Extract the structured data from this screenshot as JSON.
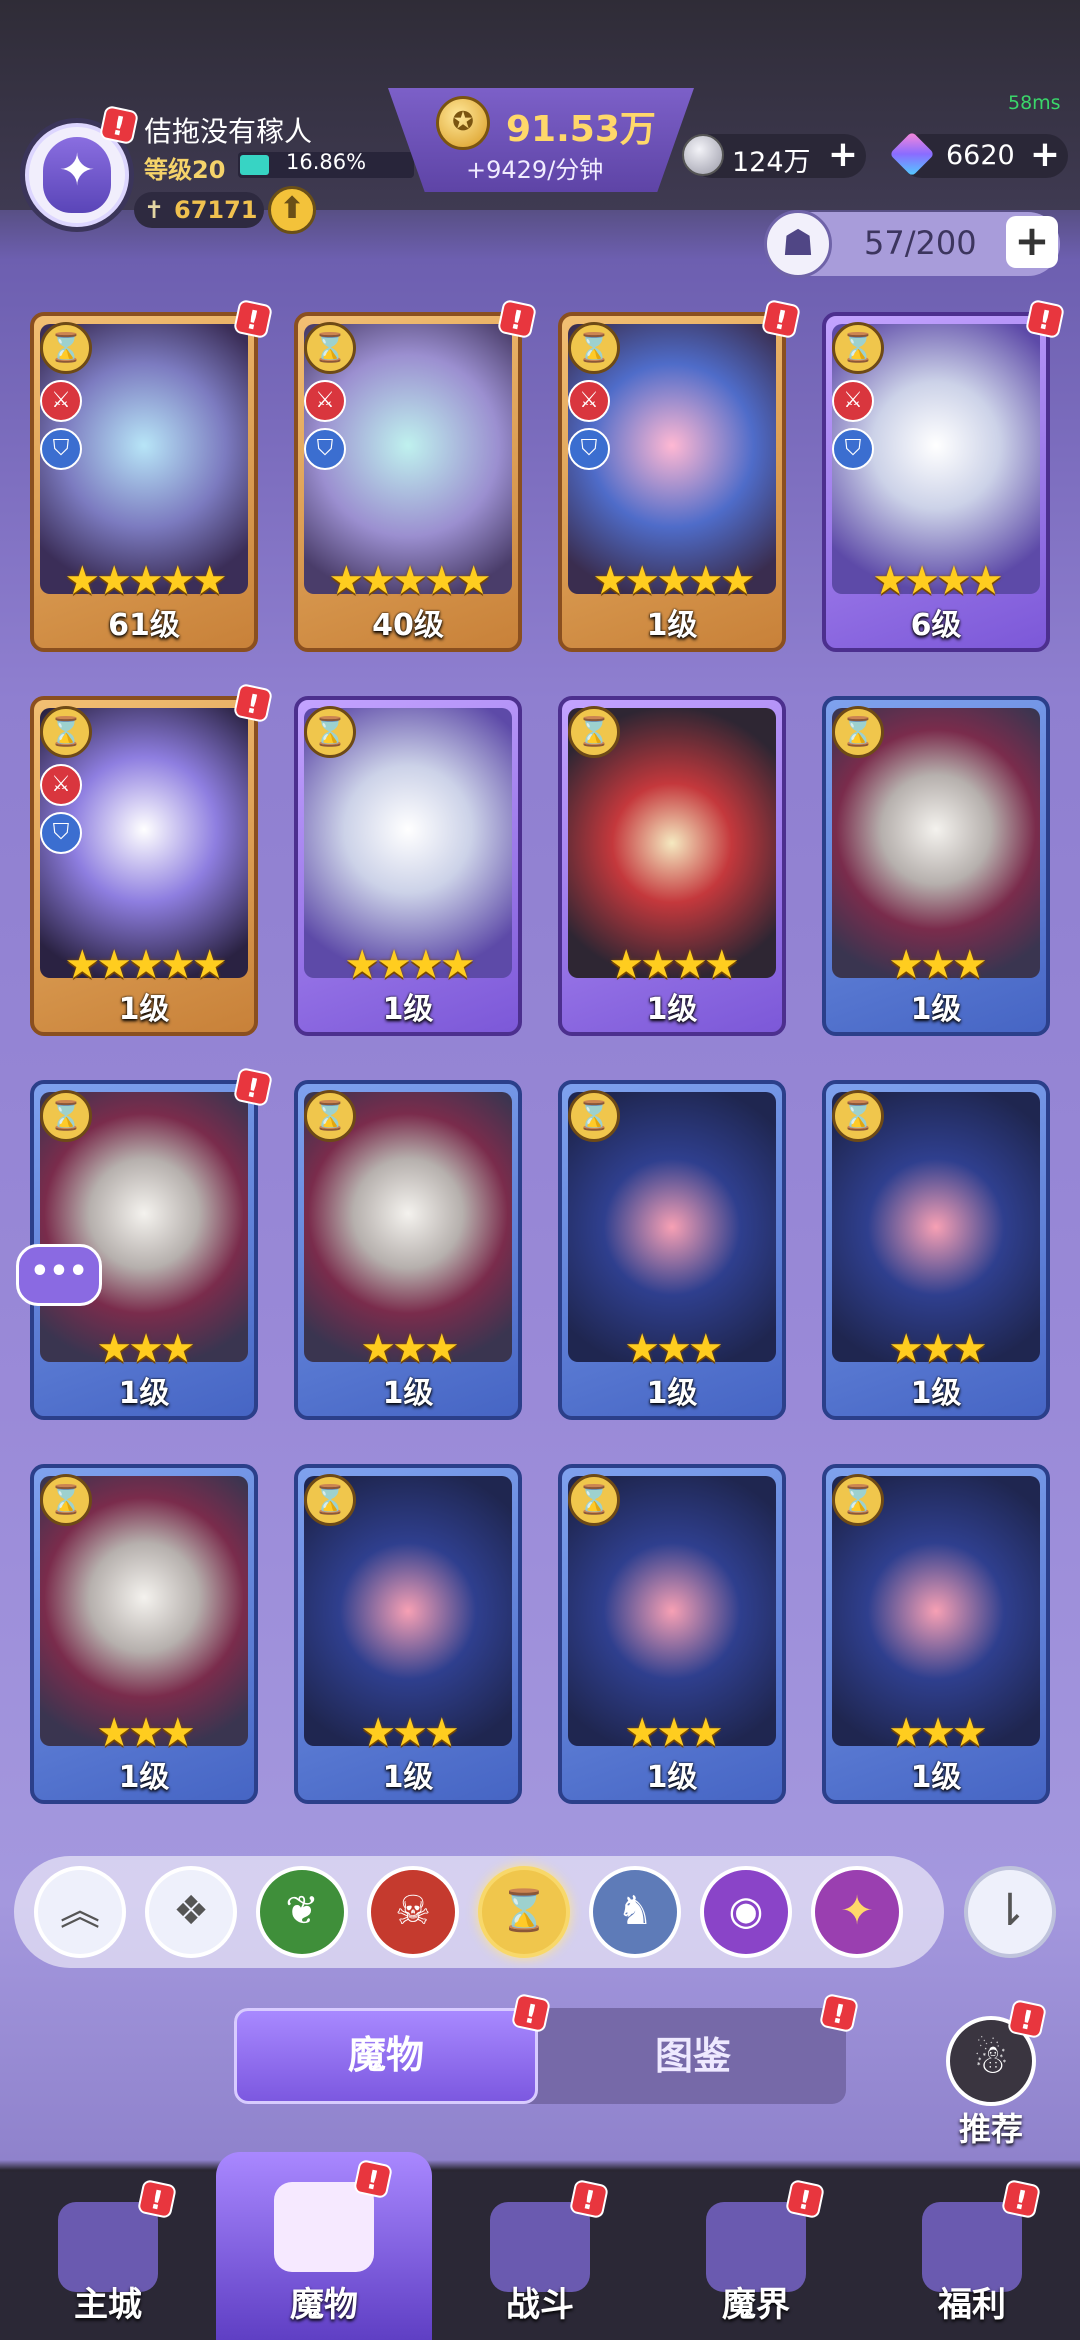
{
  "status": {
    "fps": "58ms"
  },
  "player": {
    "name": "佶拖没有稼人",
    "level": "等级20",
    "xp_percent": "16.86%",
    "xp_fraction": 0.1686,
    "power": "67171"
  },
  "resources": {
    "gold": "91.53万",
    "gold_rate": "+9429/分钟",
    "silver": "124万",
    "gems": "6620"
  },
  "capacity": {
    "text": "57/200"
  },
  "cards": [
    {
      "level": "61级",
      "stars": "★★★★★",
      "frame": "gold",
      "art": "art-a",
      "roles": true,
      "alert": true
    },
    {
      "level": "40级",
      "stars": "★★★★★",
      "frame": "gold",
      "art": "art-b",
      "roles": true,
      "alert": true
    },
    {
      "level": "1级",
      "stars": "★★★★★",
      "frame": "gold",
      "art": "art-c",
      "roles": true,
      "alert": true
    },
    {
      "level": "6级",
      "stars": "★★★★",
      "frame": "purple",
      "art": "art-d",
      "roles": true,
      "alert": true
    },
    {
      "level": "1级",
      "stars": "★★★★★",
      "frame": "gold",
      "art": "art-e",
      "roles": true,
      "alert": true
    },
    {
      "level": "1级",
      "stars": "★★★★",
      "frame": "purple",
      "art": "art-d",
      "roles": false,
      "alert": false
    },
    {
      "level": "1级",
      "stars": "★★★★",
      "frame": "purple",
      "art": "art-f",
      "roles": false,
      "alert": false
    },
    {
      "level": "1级",
      "stars": "★★★",
      "frame": "blue",
      "art": "art-g",
      "roles": false,
      "alert": false
    },
    {
      "level": "1级",
      "stars": "★★★",
      "frame": "blue",
      "art": "art-g",
      "roles": false,
      "alert": true
    },
    {
      "level": "1级",
      "stars": "★★★",
      "frame": "blue",
      "art": "art-g",
      "roles": false,
      "alert": false
    },
    {
      "level": "1级",
      "stars": "★★★",
      "frame": "blue",
      "art": "art-h",
      "roles": false,
      "alert": false
    },
    {
      "level": "1级",
      "stars": "★★★",
      "frame": "blue",
      "art": "art-h",
      "roles": false,
      "alert": false
    },
    {
      "level": "1级",
      "stars": "★★★",
      "frame": "blue",
      "art": "art-g",
      "roles": false,
      "alert": false
    },
    {
      "level": "1级",
      "stars": "★★★",
      "frame": "blue",
      "art": "art-h",
      "roles": false,
      "alert": false
    },
    {
      "level": "1级",
      "stars": "★★★",
      "frame": "blue",
      "art": "art-h",
      "roles": false,
      "alert": false
    },
    {
      "level": "1级",
      "stars": "★★★",
      "frame": "blue",
      "art": "art-h",
      "roles": false,
      "alert": false
    }
  ],
  "filters": [
    {
      "name": "collapse-icon",
      "glyph": "︽",
      "color": "#eef0fb",
      "fg": "#555"
    },
    {
      "name": "all-factions-icon",
      "glyph": "❖",
      "color": "#eef0fb",
      "fg": "#555"
    },
    {
      "name": "nature-faction-icon",
      "glyph": "❦",
      "color": "#3f8f3a",
      "fg": "#fff"
    },
    {
      "name": "demon-faction-icon",
      "glyph": "☠",
      "color": "#c53a2e",
      "fg": "#fff"
    },
    {
      "name": "hourglass-faction-icon",
      "glyph": "⌛",
      "color": "#f0c64c",
      "fg": "#5a3a10"
    },
    {
      "name": "dragon-faction-icon",
      "glyph": "♞",
      "color": "#5e7bb8",
      "fg": "#fff"
    },
    {
      "name": "eye-faction-icon",
      "glyph": "◉",
      "color": "#8a44c8",
      "fg": "#fff"
    },
    {
      "name": "arcane-faction-icon",
      "glyph": "✦",
      "color": "#9a3fb0",
      "fg": "#ffd86a"
    }
  ],
  "tabs": {
    "active": "魔物",
    "inactive": "图鉴"
  },
  "recommend": {
    "label": "推荐"
  },
  "nav": [
    {
      "label": "主城",
      "color": "#6a5ab0"
    },
    {
      "label": "魔物",
      "color": "#f6e9ff"
    },
    {
      "label": "战斗",
      "color": "#6a5ab0"
    },
    {
      "label": "魔界",
      "color": "#6a5ab0"
    },
    {
      "label": "福利",
      "color": "#6a5ab0"
    }
  ]
}
